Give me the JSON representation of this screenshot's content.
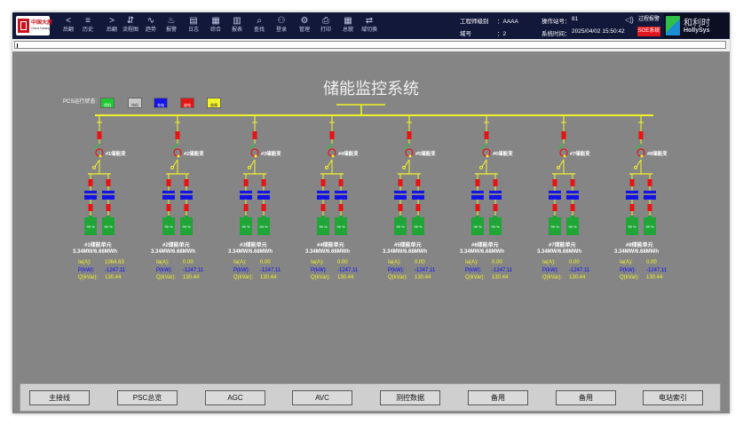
{
  "toolbar": {
    "logo": {
      "cn": "中国大唐",
      "en": "China Datang"
    },
    "buttons": [
      {
        "label": "后翻",
        "icon": "chevron-left-icon",
        "glyph": "<"
      },
      {
        "label": "历史",
        "icon": "menu-icon",
        "glyph": "≡"
      },
      {
        "label": "后翻",
        "icon": "chevron-right-icon",
        "glyph": ">"
      },
      {
        "label": "流程图",
        "icon": "flow-icon",
        "glyph": "⇵"
      },
      {
        "label": "趋势",
        "icon": "trend-icon",
        "glyph": "∿"
      },
      {
        "label": "报警",
        "icon": "alarm-bell-icon",
        "glyph": "♨"
      },
      {
        "label": "日志",
        "icon": "log-icon",
        "glyph": "▤"
      },
      {
        "label": "综合",
        "icon": "summary-icon",
        "glyph": "▦"
      },
      {
        "label": "报表",
        "icon": "report-icon",
        "glyph": "▥"
      },
      {
        "label": "查找",
        "icon": "search-icon",
        "glyph": "⌕"
      },
      {
        "label": "登录",
        "icon": "user-icon",
        "glyph": "⚇"
      },
      {
        "label": "管理",
        "icon": "gear-icon",
        "glyph": "⚙"
      },
      {
        "label": "打印",
        "icon": "printer-icon",
        "glyph": "⎙"
      },
      {
        "label": "总貌",
        "icon": "overview-icon",
        "glyph": "▦"
      },
      {
        "label": "域切换",
        "icon": "domain-switch-icon",
        "glyph": "⇄"
      }
    ],
    "info": {
      "eng_level_label": "工程师级别",
      "eng_level_value": "：AAAA",
      "station_label": "操作站号：",
      "station_value": "81",
      "zone_label": "域号",
      "zone_value": "：2",
      "time_label": "系统时间：",
      "time_value": "2025/04/02 15:50:42"
    },
    "alarm": {
      "process": "过程报警",
      "soe": "SOE系统"
    },
    "brand": {
      "cn": "和利时",
      "en": "HollySys"
    }
  },
  "main": {
    "title": "储能监控系统",
    "pcs_status_label": "PCS运行状态:",
    "pcs_states": [
      {
        "label": "停机",
        "color": "#22c832"
      },
      {
        "label": "待机",
        "color": "#c8c8c8"
      },
      {
        "label": "充电",
        "color": "#1414e6"
      },
      {
        "label": "放电",
        "color": "#e61414"
      },
      {
        "label": "故障",
        "color": "#f2f22a"
      }
    ],
    "units": [
      {
        "xfmr": "#1储能变",
        "unit": "#1储能单元",
        "capacity": "3.34MW/6.68MWh",
        "ia_label": "Ia(A):",
        "ia": "1064.63",
        "p_label": "P(kW):",
        "p": "-1247.11",
        "q_label": "Q(kVar):",
        "q": "130.44"
      },
      {
        "xfmr": "#2储能变",
        "unit": "#2储能单元",
        "capacity": "3.34MW/6.68MWh",
        "ia_label": "Ia(A):",
        "ia": "0.00",
        "p_label": "P(kW):",
        "p": "-1247.11",
        "q_label": "Q(kVar):",
        "q": "130.44"
      },
      {
        "xfmr": "#3储能变",
        "unit": "#3储能单元",
        "capacity": "3.34MW/6.68MWh",
        "ia_label": "Ia(A):",
        "ia": "0.00",
        "p_label": "P(kW):",
        "p": "-1247.11",
        "q_label": "Q(kVar):",
        "q": "130.44"
      },
      {
        "xfmr": "#4储能变",
        "unit": "#4储能单元",
        "capacity": "3.34MW/6.68MWh",
        "ia_label": "Ia(A):",
        "ia": "0.00",
        "p_label": "P(kW):",
        "p": "-1247.11",
        "q_label": "Q(kVar):",
        "q": "130.44"
      },
      {
        "xfmr": "#5储能变",
        "unit": "#5储能单元",
        "capacity": "3.34MW/6.68MWh",
        "ia_label": "Ia(A):",
        "ia": "0.00",
        "p_label": "P(kW):",
        "p": "-1247.11",
        "q_label": "Q(kVar):",
        "q": "130.44"
      },
      {
        "xfmr": "#6储能变",
        "unit": "#6储能单元",
        "capacity": "3.34MW/6.68MWh",
        "ia_label": "Ia(A):",
        "ia": "0.00",
        "p_label": "P(kW):",
        "p": "-1247.11",
        "q_label": "Q(kVar):",
        "q": "130.44"
      },
      {
        "xfmr": "#7储能变",
        "unit": "#7储能单元",
        "capacity": "3.34MW/6.68MWh",
        "ia_label": "Ia(A):",
        "ia": "0.00",
        "p_label": "P(kW):",
        "p": "-1247.11",
        "q_label": "Q(kVar):",
        "q": "130.44"
      },
      {
        "xfmr": "#8储能变",
        "unit": "#8储能单元",
        "capacity": "3.34MW/6.68MWh",
        "ia_label": "Ia(A):",
        "ia": "0.00",
        "p_label": "P(kW):",
        "p": "-1247.11",
        "q_label": "Q(kVar):",
        "q": "130.44"
      }
    ],
    "battery_soc": "95 %",
    "colors": {
      "bus": "#f2f22a",
      "pcs": "#1414e6",
      "battery": "#1fa637",
      "breaker_closed": "#e61414",
      "breaker_open": "#22c832"
    }
  },
  "nav": {
    "buttons": [
      "主接线",
      "PSC总览",
      "AGC",
      "AVC",
      "测控数据",
      "备用",
      "备用",
      "电站索引"
    ]
  }
}
